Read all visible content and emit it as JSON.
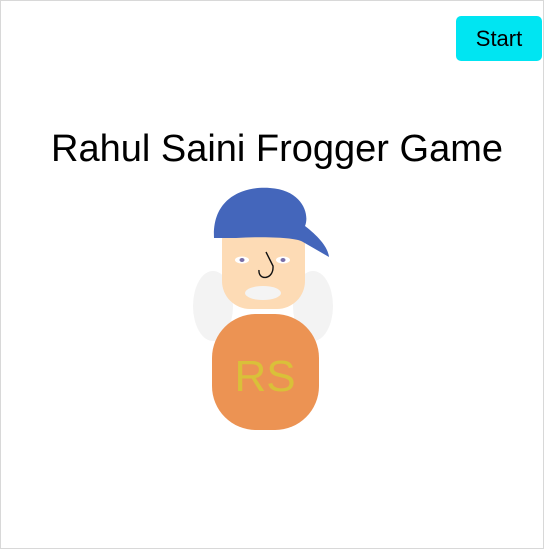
{
  "game": {
    "title": "Rahul Saini Frogger Game",
    "start_label": "Start",
    "character": {
      "monogram": "RS"
    }
  },
  "colors": {
    "start_button": "#00e5f2",
    "cap": "#4466bb",
    "face": "#fddbb5",
    "body": "#ec9353",
    "monogram_text": "#d9c039",
    "arms": "#f3f3f3"
  }
}
